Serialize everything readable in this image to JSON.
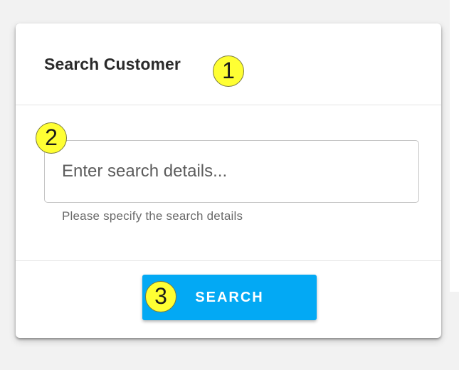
{
  "card": {
    "title": "Search Customer"
  },
  "search": {
    "placeholder": "Enter search details...",
    "value": "",
    "helper": "Please specify the search details",
    "button_label": "SEARCH"
  },
  "annotations": [
    {
      "label": "1"
    },
    {
      "label": "2"
    },
    {
      "label": "3"
    }
  ],
  "colors": {
    "accent": "#03a9f4",
    "badge": "#ffff33",
    "background": "#f2f2f2",
    "card": "#ffffff"
  }
}
